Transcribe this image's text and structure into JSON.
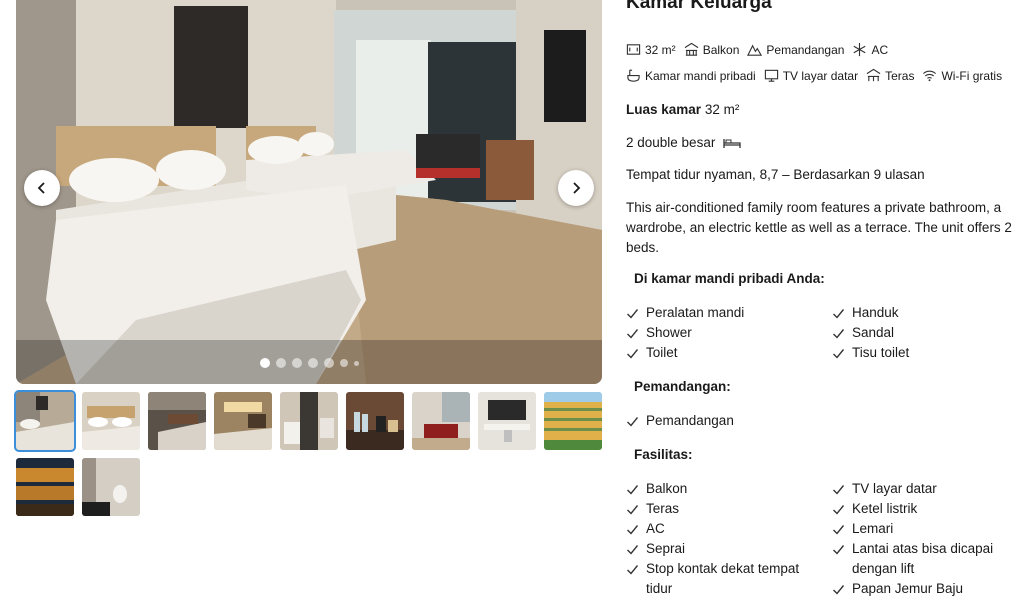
{
  "room": {
    "title": "Kamar Keluarga",
    "facilities_row1": [
      {
        "icon": "room-size-icon",
        "label": "32 m²"
      },
      {
        "icon": "balcony-icon",
        "label": "Balkon"
      },
      {
        "icon": "mountain-view-icon",
        "label": "Pemandangan"
      },
      {
        "icon": "snowflake-ac-icon",
        "label": "AC"
      }
    ],
    "facilities_row2": [
      {
        "icon": "private-bathroom-icon",
        "label": "Kamar mandi pribadi"
      },
      {
        "icon": "tv-icon",
        "label": "TV layar datar"
      },
      {
        "icon": "terrace-icon",
        "label": "Teras"
      },
      {
        "icon": "wifi-icon",
        "label": "Wi-Fi gratis"
      }
    ],
    "size_label": "Luas kamar",
    "size_value": "32 m²",
    "beds": "2 double besar",
    "rating_text": "Tempat tidur nyaman, 8,7 – Berdasarkan 9 ulasan",
    "description": "This air-conditioned family room features a private bathroom, a wardrobe, an electric kettle as well as a terrace. The unit offers 2 beds."
  },
  "sections": {
    "bathroom": {
      "title": "Di kamar mandi pribadi Anda:",
      "items": [
        "Peralatan mandi",
        "Handuk",
        "Shower",
        "Sandal",
        "Toilet",
        "Tisu toilet"
      ]
    },
    "view": {
      "title": "Pemandangan:",
      "items": [
        "Pemandangan"
      ]
    },
    "facilities": {
      "title": "Fasilitas:",
      "items": [
        "Balkon",
        "TV layar datar",
        "Teras",
        "Ketel listrik",
        "AC",
        "Lemari",
        "Seprai",
        "Lantai atas bisa dicapai dengan lift",
        "Stop kontak dekat tempat tidur",
        "Papan Jemur Baju"
      ]
    }
  },
  "gallery": {
    "prev_icon": "chevron-left-icon",
    "next_icon": "chevron-right-icon",
    "slide_count": 7,
    "active_slide": 1,
    "thumbnail_count": 11,
    "selected_thumbnail": 1
  },
  "colors": {
    "accent": "#3b8ed9",
    "text": "#1a1a1a"
  }
}
